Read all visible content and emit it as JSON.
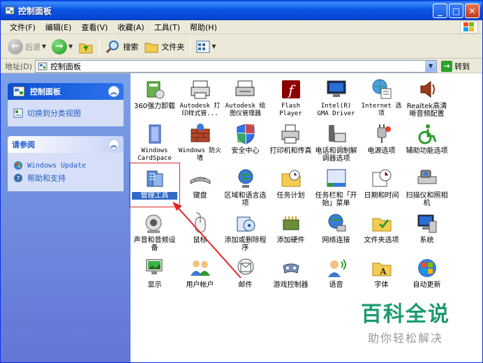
{
  "window": {
    "title": "控制面板"
  },
  "menubar": [
    "文件(F)",
    "编辑(E)",
    "查看(V)",
    "收藏(A)",
    "工具(T)",
    "帮助(H)"
  ],
  "toolbar": {
    "back": "后退",
    "search": "搜索",
    "folders": "文件夹"
  },
  "address": {
    "label": "地址(D)",
    "value": "控制面板",
    "go": "转到"
  },
  "sidebar": {
    "panel1": {
      "title": "控制面板",
      "link": "切换到分类视图"
    },
    "panel2": {
      "title": "请参阅",
      "links": [
        "Windows Update",
        "帮助和支持"
      ]
    }
  },
  "items": [
    "360强力卸载",
    "Autodesk 打印样式管...",
    "Autodesk 绘图仪管理器",
    "Flash Player",
    "Intel(R) GMA Driver",
    "Internet 选项",
    "Realtek高清晰音频配置",
    "Windows CardSpace",
    "Windows 防火墙",
    "安全中心",
    "打印机和传真",
    "电话和调制解调器选项",
    "电源选项",
    "辅助功能选项",
    "管理工具",
    "键盘",
    "区域和语言选项",
    "任务计划",
    "任务栏和「开始」菜单",
    "日期和时间",
    "扫描仪和照相机",
    "声音和音频设备",
    "鼠标",
    "添加或删除程序",
    "添加硬件",
    "网络连接",
    "文件夹选项",
    "系统",
    "显示",
    "用户帐户",
    "邮件",
    "游戏控制器",
    "语音",
    "字体",
    "自动更新"
  ],
  "watermark": {
    "title": "百科全说",
    "subtitle": "助你轻松解决"
  }
}
